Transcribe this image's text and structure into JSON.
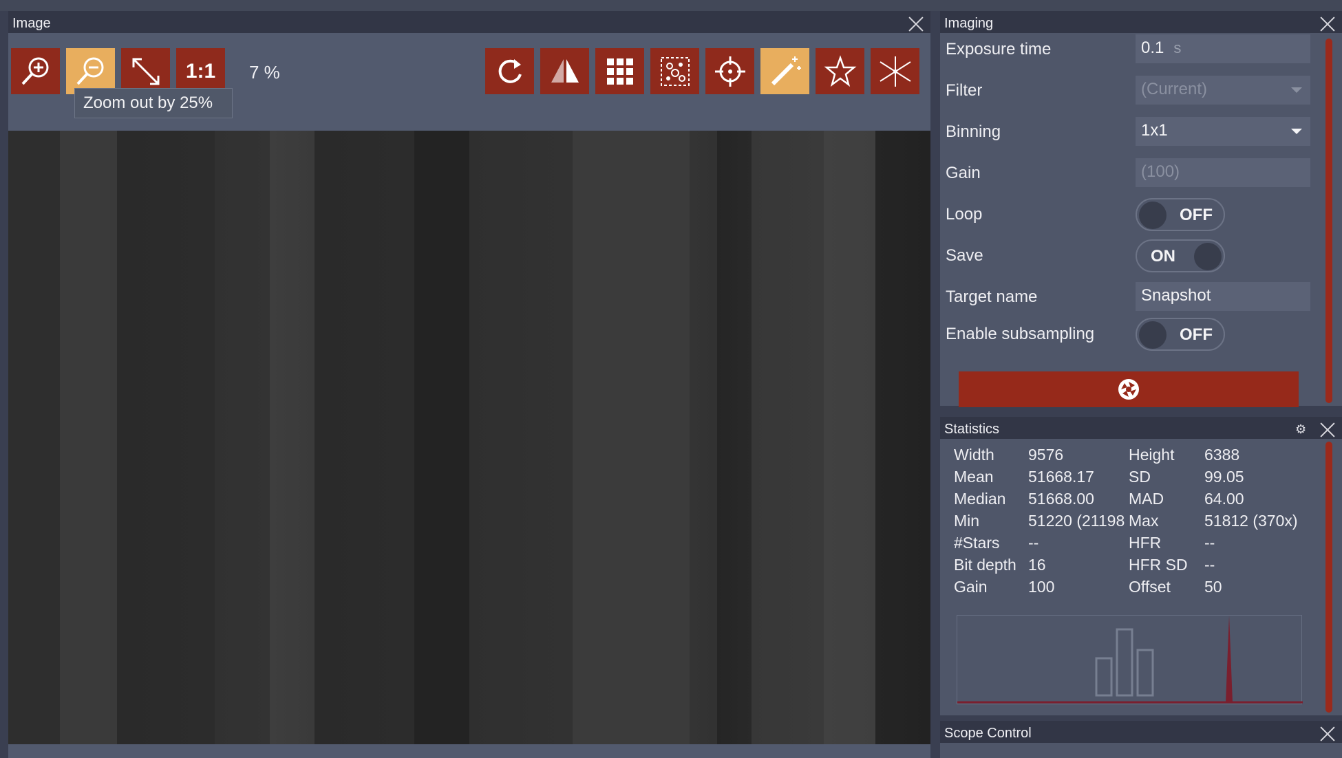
{
  "image_panel": {
    "title": "Image",
    "zoom_level": "7 %",
    "tooltip": "Zoom out by 25%",
    "one_to_one_label": "1:1",
    "tools_left": [
      {
        "name": "zoom-in-icon",
        "active": false
      },
      {
        "name": "zoom-out-icon",
        "active": true
      },
      {
        "name": "fit-to-screen-icon",
        "active": false
      },
      {
        "name": "one-to-one-button",
        "active": false
      }
    ],
    "tools_right": [
      {
        "name": "rotate-icon",
        "active": false
      },
      {
        "name": "flip-icon",
        "active": false
      },
      {
        "name": "grid-icon",
        "active": false
      },
      {
        "name": "star-detection-icon",
        "active": false
      },
      {
        "name": "crosshair-icon",
        "active": false
      },
      {
        "name": "magic-wand-icon",
        "active": true
      },
      {
        "name": "star-icon",
        "active": false
      },
      {
        "name": "bahtinov-icon",
        "active": false
      }
    ]
  },
  "imaging_panel": {
    "title": "Imaging",
    "exposure": {
      "label": "Exposure time",
      "value": "0.1",
      "unit": "s"
    },
    "filter": {
      "label": "Filter",
      "value": "(Current)"
    },
    "binning": {
      "label": "Binning",
      "value": "1x1"
    },
    "gain": {
      "label": "Gain",
      "value": "(100)"
    },
    "loop": {
      "label": "Loop",
      "state": "OFF"
    },
    "save": {
      "label": "Save",
      "state": "ON"
    },
    "target_name": {
      "label": "Target name",
      "value": "Snapshot"
    },
    "subsampling": {
      "label": "Enable subsampling",
      "state": "OFF"
    },
    "capture_icon": "aperture-icon"
  },
  "statistics_panel": {
    "title": "Statistics",
    "rows": [
      {
        "k1": "Width",
        "v1": "9576",
        "k2": "Height",
        "v2": "6388"
      },
      {
        "k1": "Mean",
        "v1": "51668.17",
        "k2": "SD",
        "v2": "99.05"
      },
      {
        "k1": "Median",
        "v1": "51668.00",
        "k2": "MAD",
        "v2": "64.00"
      },
      {
        "k1": "Min",
        "v1": "51220 (21198",
        "k2": "Max",
        "v2": "51812 (370x)"
      },
      {
        "k1": "#Stars",
        "v1": "--",
        "k2": "HFR",
        "v2": "--"
      },
      {
        "k1": "Bit depth",
        "v1": "16",
        "k2": "HFR SD",
        "v2": "--"
      },
      {
        "k1": "Gain",
        "v1": "100",
        "k2": "Offset",
        "v2": "50"
      }
    ]
  },
  "scope_panel": {
    "title": "Scope Control"
  },
  "colors": {
    "accent": "#8f2a1c",
    "active": "#e8ae5e",
    "panel": "#4f5669",
    "header": "#323646"
  }
}
